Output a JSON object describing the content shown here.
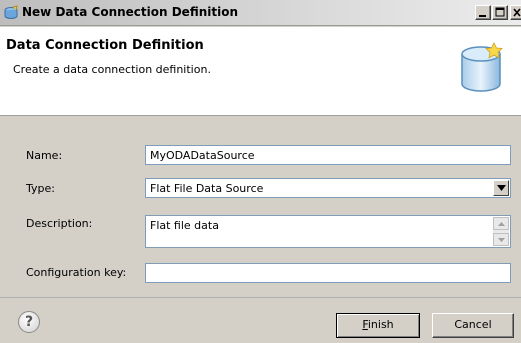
{
  "window": {
    "title": "New Data Connection Definition"
  },
  "header": {
    "title": "Data Connection Definition",
    "subtitle": "Create a data connection definition."
  },
  "form": {
    "name_label": "Name:",
    "name_value": "MyODADataSource",
    "type_label": "Type:",
    "type_value": "Flat File Data Source",
    "description_label": "Description:",
    "description_value": "Flat file data",
    "config_label": "Configuration key:",
    "config_value": ""
  },
  "footer": {
    "help_glyph": "?",
    "finish_mnemonic": "F",
    "finish_rest": "inish",
    "cancel_label": "Cancel"
  },
  "icons": {
    "title": "database-wizard-icon",
    "header": "database-cylinder-icon",
    "help": "help-icon"
  },
  "colors": {
    "field_border": "#7f9db9",
    "dialog_bg": "#d4d0c8",
    "header_bg": "#ffffff"
  }
}
